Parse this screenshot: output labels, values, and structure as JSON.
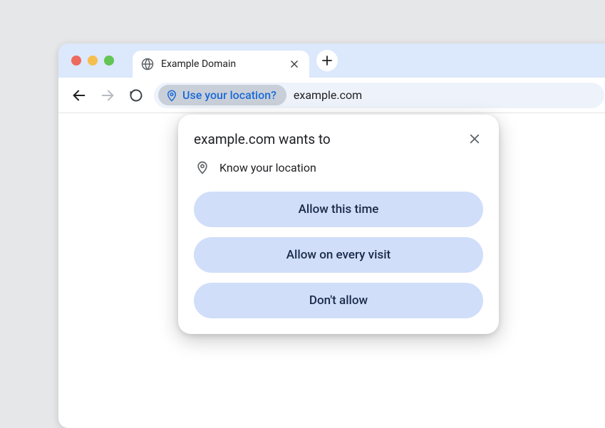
{
  "tab": {
    "title": "Example Domain"
  },
  "toolbar": {
    "permission_chip_label": "Use your location?",
    "url": "example.com"
  },
  "dialog": {
    "origin": "example.com",
    "title_suffix": " wants to",
    "request_label": "Know your location",
    "buttons": {
      "allow_once": "Allow this time",
      "allow_always": "Allow on every visit",
      "deny": "Don't allow"
    }
  }
}
